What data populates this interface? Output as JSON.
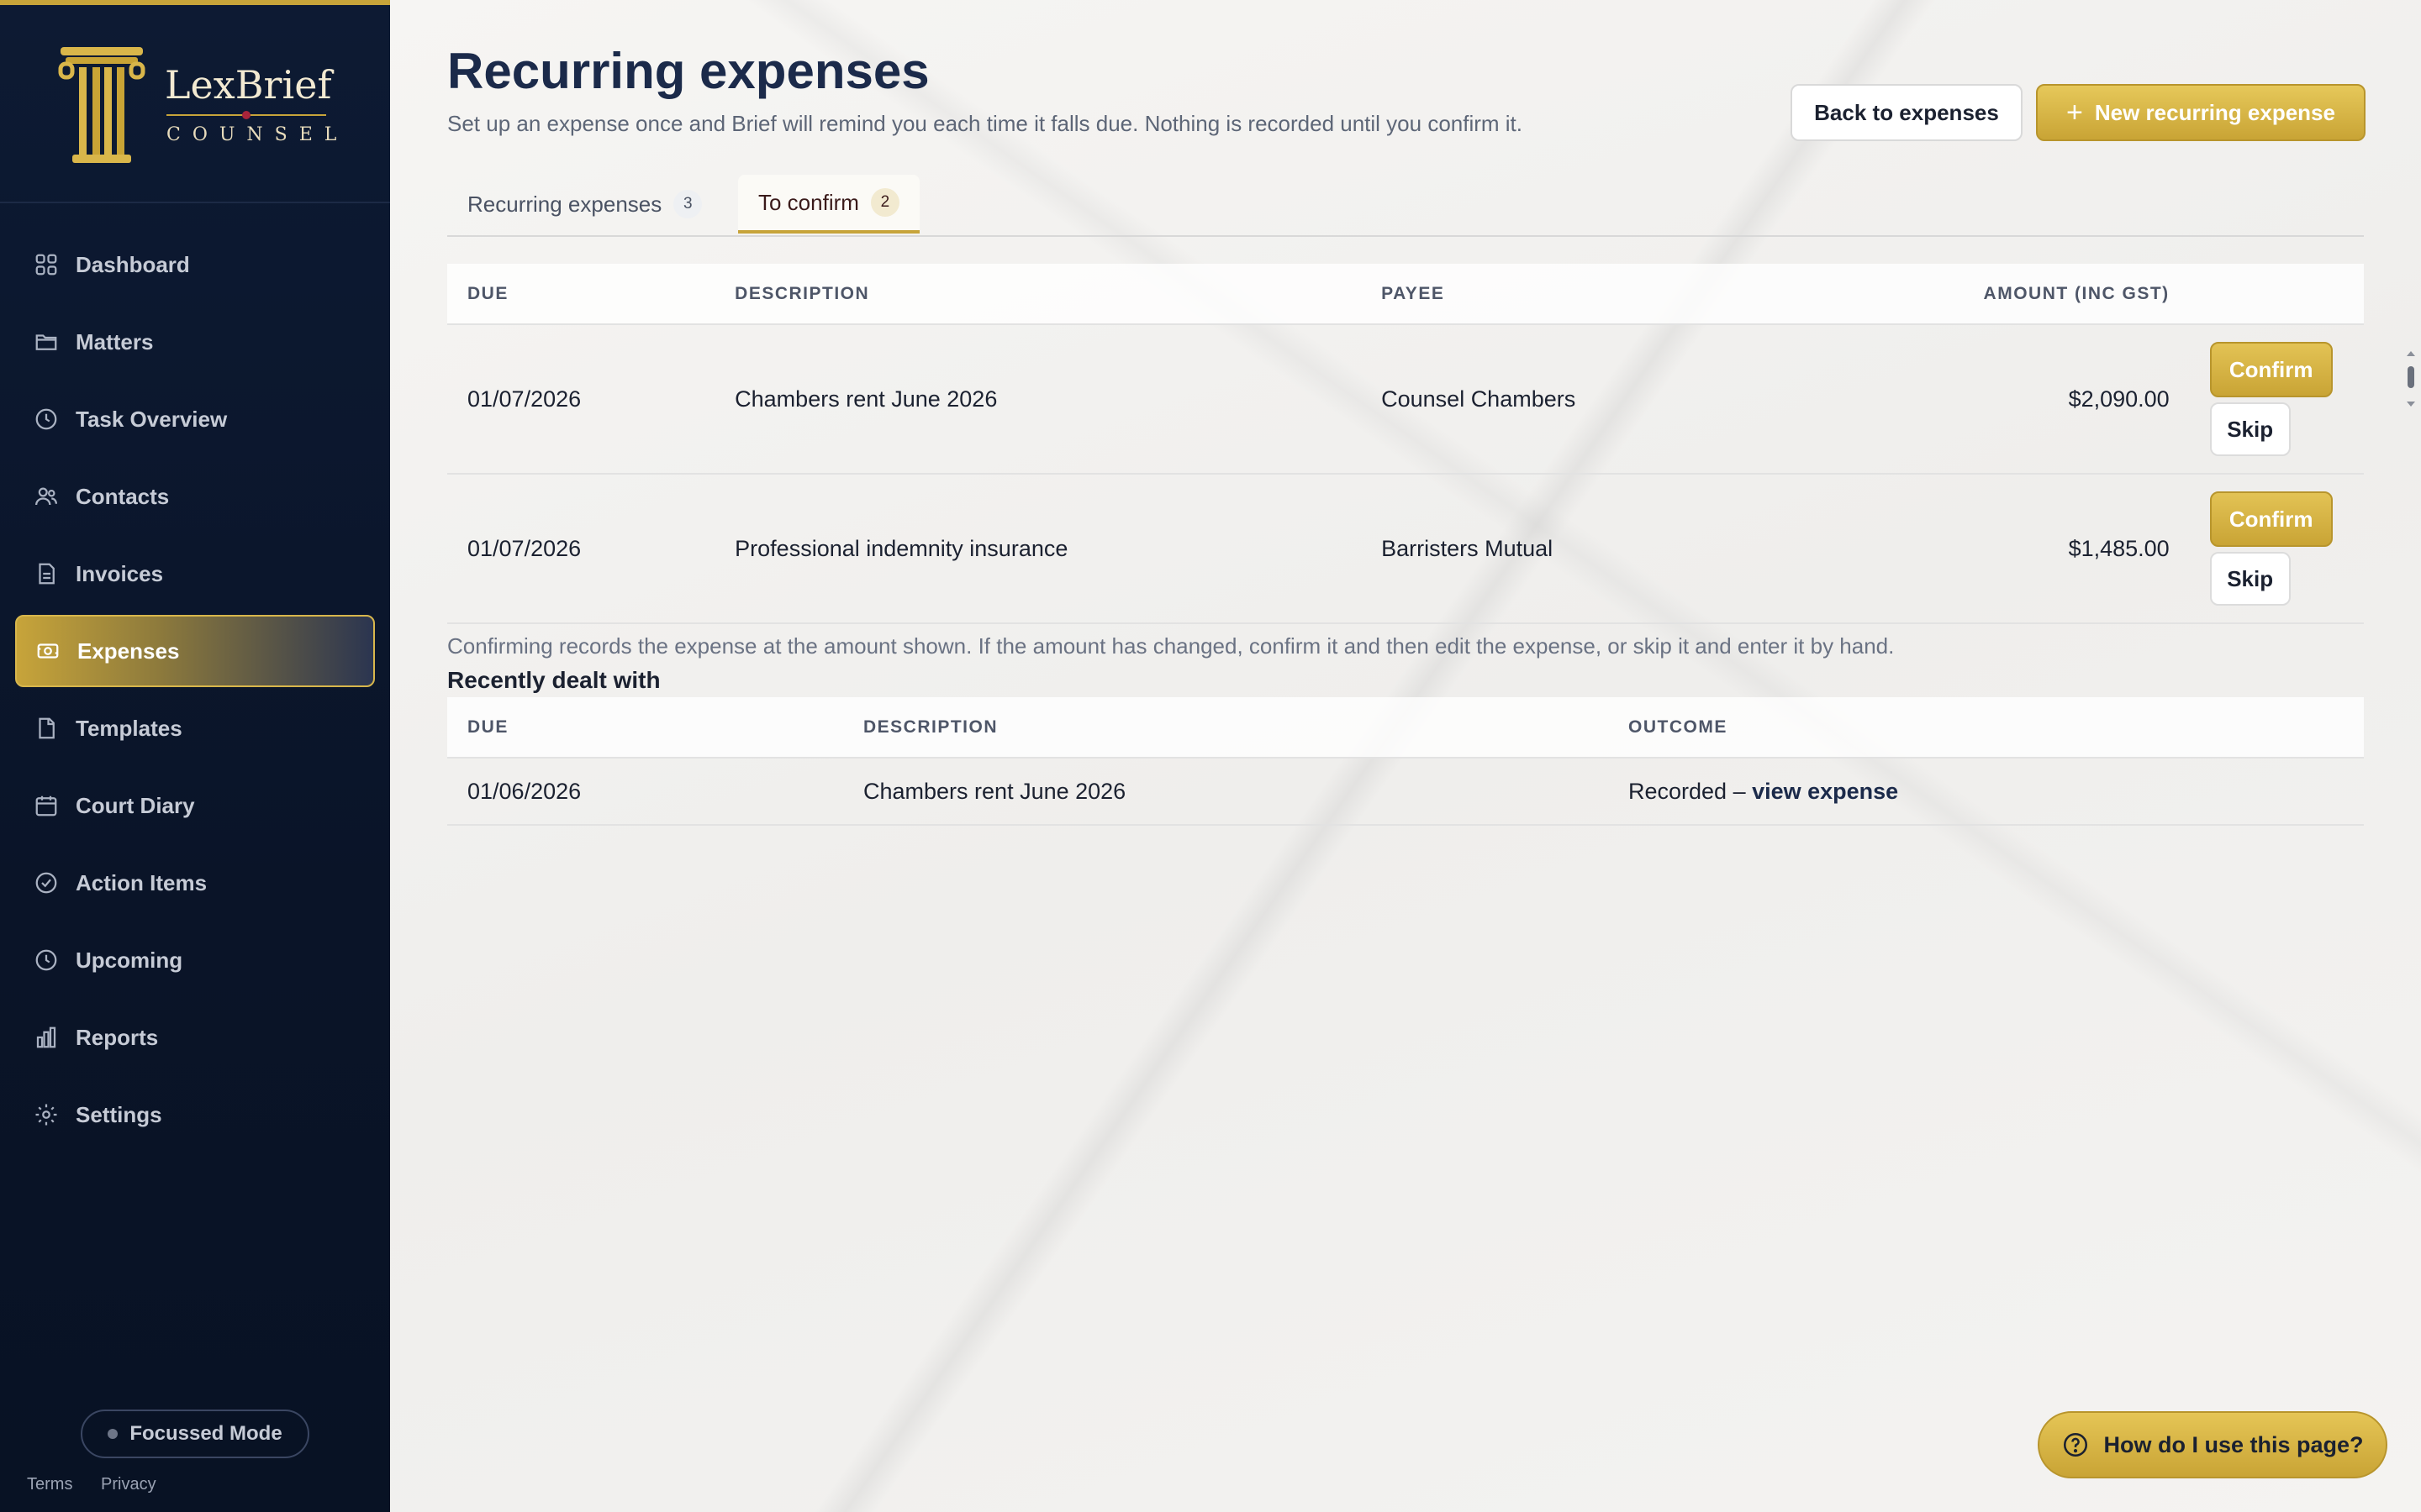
{
  "brand": {
    "name": "LexBrief",
    "sub": "COUNSEL"
  },
  "nav": [
    {
      "label": "Dashboard",
      "icon": "grid-icon"
    },
    {
      "label": "Matters",
      "icon": "folder-icon"
    },
    {
      "label": "Task Overview",
      "icon": "clock-icon"
    },
    {
      "label": "Contacts",
      "icon": "users-icon"
    },
    {
      "label": "Invoices",
      "icon": "invoice-icon"
    },
    {
      "label": "Expenses",
      "icon": "cash-icon",
      "active": true
    },
    {
      "label": "Templates",
      "icon": "file-icon"
    },
    {
      "label": "Court Diary",
      "icon": "calendar-icon"
    },
    {
      "label": "Action Items",
      "icon": "check-circle-icon"
    },
    {
      "label": "Upcoming",
      "icon": "clock-icon"
    },
    {
      "label": "Reports",
      "icon": "bar-chart-icon"
    },
    {
      "label": "Settings",
      "icon": "gear-icon"
    }
  ],
  "focus_mode": "Focussed Mode",
  "footer": {
    "terms": "Terms",
    "privacy": "Privacy"
  },
  "header": {
    "title": "Recurring expenses",
    "subtitle": "Set up an expense once and Brief will remind you each time it falls due. Nothing is recorded until you confirm it.",
    "back_label": "Back to expenses",
    "new_label": "New recurring expense",
    "new_plus": "+"
  },
  "tabs": [
    {
      "label": "Recurring expenses",
      "count": "3"
    },
    {
      "label": "To confirm",
      "count": "2",
      "active": true
    }
  ],
  "confirm_table": {
    "headers": [
      "DUE",
      "DESCRIPTION",
      "PAYEE",
      "AMOUNT (INC GST)"
    ],
    "rows": [
      {
        "due": "01/07/2026",
        "description": "Chambers rent June 2026",
        "payee": "Counsel Chambers",
        "amount": "$2,090.00",
        "confirm": "Confirm",
        "skip": "Skip"
      },
      {
        "due": "01/07/2026",
        "description": "Professional indemnity insurance",
        "payee": "Barristers Mutual",
        "amount": "$1,485.00",
        "confirm": "Confirm",
        "skip": "Skip"
      }
    ]
  },
  "note": "Confirming records the expense at the amount shown. If the amount has changed, confirm it and then edit the expense, or skip it and enter it by hand.",
  "recent": {
    "title": "Recently dealt with",
    "headers": [
      "DUE",
      "DESCRIPTION",
      "OUTCOME"
    ],
    "rows": [
      {
        "due": "01/06/2026",
        "description": "Chambers rent June 2026",
        "outcome": "Recorded – ",
        "link": "view expense"
      }
    ]
  },
  "help": "How do I use this page?",
  "colors": {
    "gold": "#c7a43a",
    "navy": "#0d1a33"
  }
}
